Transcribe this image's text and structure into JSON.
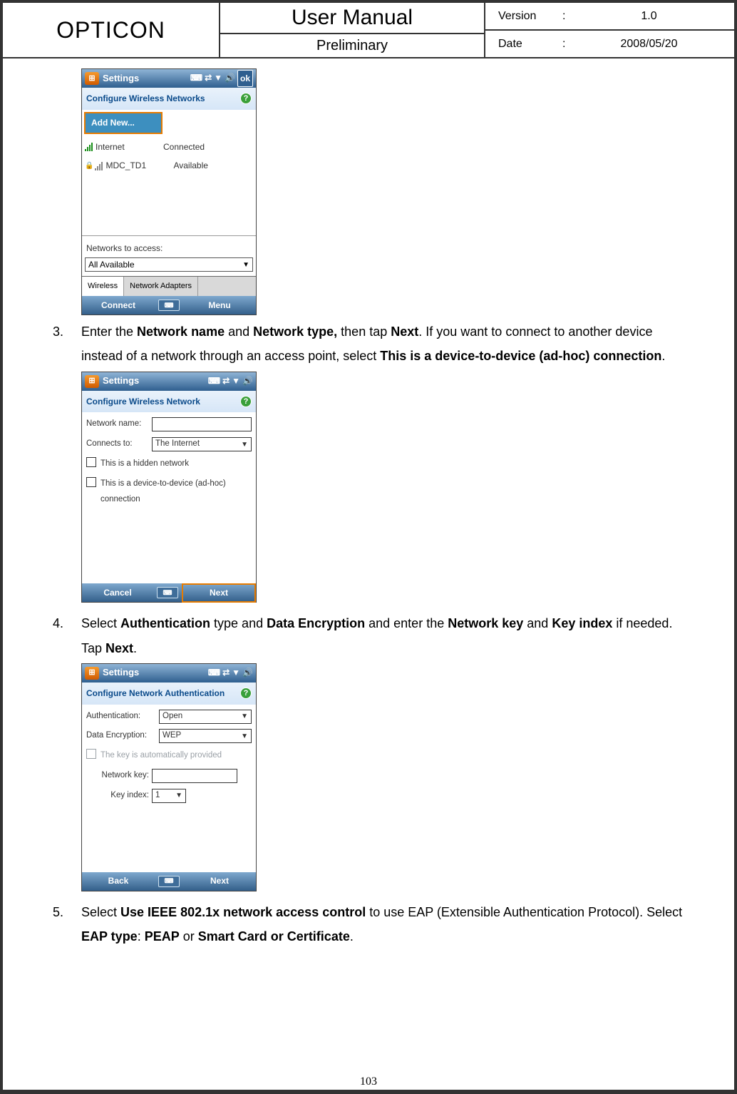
{
  "header": {
    "brand": "OPTICON",
    "title": "User Manual",
    "subtitle": "Preliminary",
    "version_label": "Version",
    "version_value": "1.0",
    "date_label": "Date",
    "date_value": "2008/05/20"
  },
  "steps": {
    "s3": {
      "num": "3.",
      "t1": "Enter the ",
      "b1": "Network name",
      "t2": " and ",
      "b2": "Network type,",
      "t3": " then tap ",
      "b3": "Next",
      "t4": ". If you want to connect to another device instead of a network through an access point, select ",
      "b4": "This is a device-to-device (ad-hoc) connection",
      "t5": "."
    },
    "s4": {
      "num": "4.",
      "t1": "Select ",
      "b1": "Authentication",
      "t2": " type and ",
      "b2": "Data Encryption",
      "t3": " and enter the ",
      "b3": "Network key",
      "t4": " and ",
      "b4": "Key index",
      "t5": " if needed. Tap ",
      "b5": "Next",
      "t6": "."
    },
    "s5": {
      "num": "5.",
      "t1": "Select ",
      "b1": "Use IEEE 802.1x network access control",
      "t2": " to use EAP (Extensible Authentication Protocol). Select ",
      "b2": "EAP type",
      "t3": ": ",
      "b3": "PEAP",
      "t4": " or ",
      "b4": "Smart Card or Certificate",
      "t5": "."
    }
  },
  "phone1": {
    "title": "Settings",
    "ok": "ok",
    "section": "Configure Wireless Networks",
    "add_new": "Add New...",
    "net1_name": "Internet",
    "net1_status": "Connected",
    "net2_name": "MDC_TD1",
    "net2_status": "Available",
    "access_label": "Networks to access:",
    "access_value": "All Available",
    "tab1": "Wireless",
    "tab2": "Network Adapters",
    "left": "Connect",
    "right": "Menu"
  },
  "phone2": {
    "title": "Settings",
    "section": "Configure Wireless Network",
    "name_lbl": "Network name:",
    "conn_lbl": "Connects to:",
    "conn_val": "The Internet",
    "chk1": "This is a hidden network",
    "chk2": "This is a device-to-device (ad-hoc) connection",
    "left": "Cancel",
    "right": "Next"
  },
  "phone3": {
    "title": "Settings",
    "section": "Configure Network Authentication",
    "auth_lbl": "Authentication:",
    "auth_val": "Open",
    "enc_lbl": "Data Encryption:",
    "enc_val": "WEP",
    "autokey": "The key is automatically provided",
    "key_lbl": "Network key:",
    "idx_lbl": "Key index:",
    "idx_val": "1",
    "left": "Back",
    "right": "Next"
  },
  "page_number": "103"
}
